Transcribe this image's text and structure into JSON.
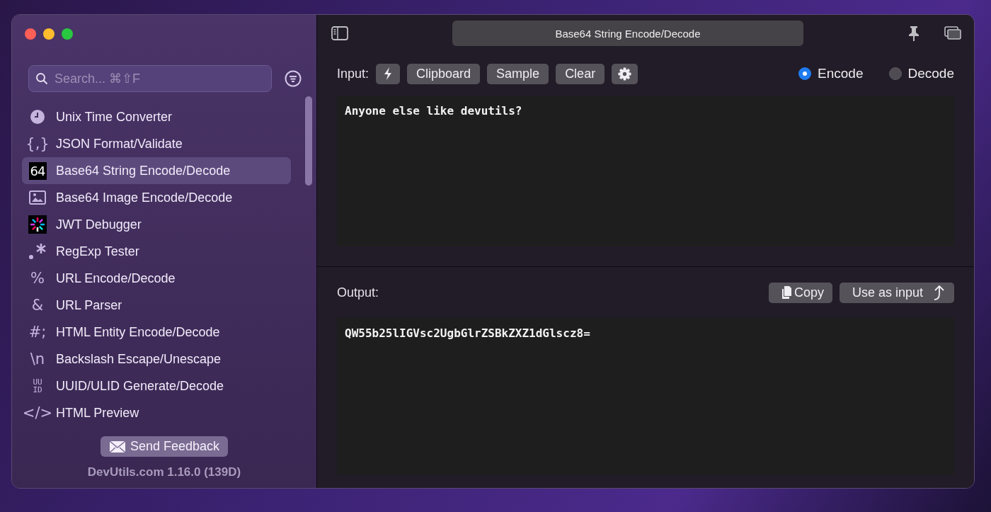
{
  "window": {
    "title": "Base64 String Encode/Decode",
    "traffic_lights": [
      {
        "color": "#fe5f57"
      },
      {
        "color": "#febc2e"
      },
      {
        "color": "#28c840"
      }
    ]
  },
  "sidebar": {
    "search": {
      "placeholder": "Search... ⌘⇧F"
    },
    "items": [
      {
        "label": "Unix Time Converter",
        "kind": "clock",
        "selected": false
      },
      {
        "label": "JSON Format/Validate",
        "kind": "glyph",
        "glyph": "{,}",
        "selected": false
      },
      {
        "label": "Base64 String Encode/Decode",
        "kind": "tile",
        "glyph": "64",
        "selected": true
      },
      {
        "label": "Base64 Image Encode/Decode",
        "kind": "image",
        "selected": false
      },
      {
        "label": "JWT Debugger",
        "kind": "jwt",
        "selected": false
      },
      {
        "label": "RegExp Tester",
        "kind": "regex",
        "selected": false
      },
      {
        "label": "URL Encode/Decode",
        "kind": "glyph",
        "glyph": "%",
        "selected": false
      },
      {
        "label": "URL Parser",
        "kind": "glyph",
        "glyph": "&",
        "selected": false
      },
      {
        "label": "HTML Entity Encode/Decode",
        "kind": "glyph",
        "glyph": "#;",
        "selected": false
      },
      {
        "label": "Backslash Escape/Unescape",
        "kind": "glyph",
        "glyph": "\\n",
        "selected": false
      },
      {
        "label": "UUID/ULID Generate/Decode",
        "kind": "stacked",
        "glyph": [
          "UU",
          "ID"
        ],
        "selected": false
      },
      {
        "label": "HTML Preview",
        "kind": "glyph",
        "glyph": "</>",
        "selected": false
      }
    ],
    "feedback_button": "Send Feedback",
    "version": "DevUtils.com 1.16.0 (139D)"
  },
  "input": {
    "label": "Input:",
    "buttons": [
      "Clipboard",
      "Sample",
      "Clear"
    ],
    "modes": [
      {
        "label": "Encode",
        "selected": true
      },
      {
        "label": "Decode",
        "selected": false
      }
    ],
    "value": "Anyone else like devutils?"
  },
  "output": {
    "label": "Output:",
    "copy_button": "Copy",
    "use_button": "Use as input",
    "value": "QW55b25lIGVsc2UgbGlrZSBkZXZ1dGlscz8="
  }
}
